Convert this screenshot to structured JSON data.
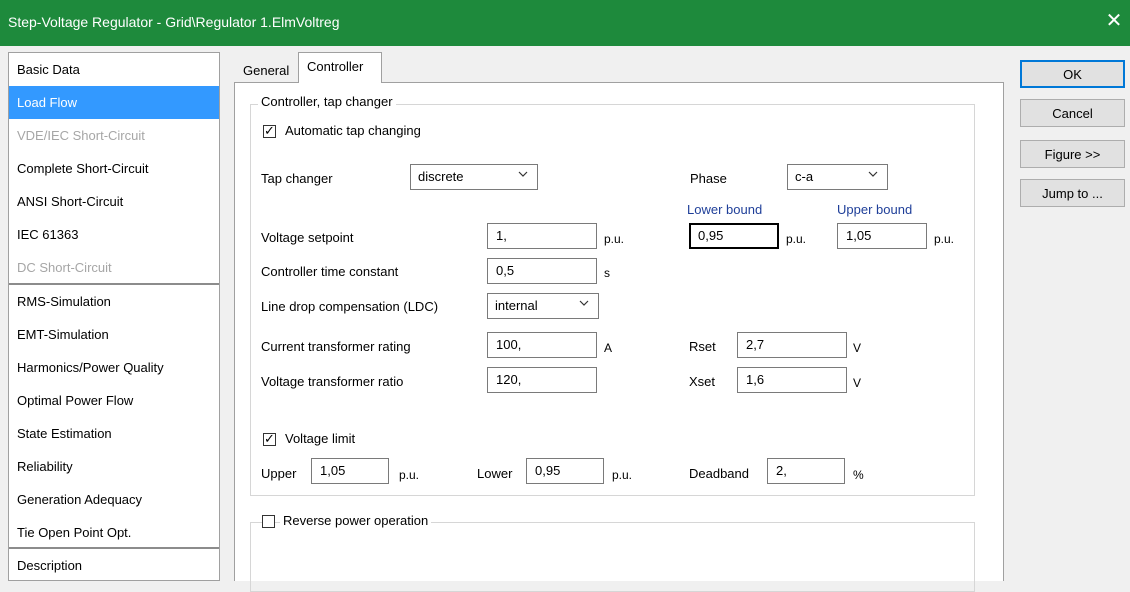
{
  "window": {
    "title": "Step-Voltage Regulator - Grid\\Regulator 1.ElmVoltreg",
    "close_glyph": "✕"
  },
  "sidebar": {
    "items": [
      {
        "label": "Basic Data",
        "state": "normal"
      },
      {
        "label": "Load Flow",
        "state": "selected"
      },
      {
        "label": "VDE/IEC Short-Circuit",
        "state": "disabled"
      },
      {
        "label": "Complete Short-Circuit",
        "state": "normal"
      },
      {
        "label": "ANSI Short-Circuit",
        "state": "normal"
      },
      {
        "label": "IEC 61363",
        "state": "normal"
      },
      {
        "label": "DC Short-Circuit",
        "state": "disabled"
      },
      {
        "label": "RMS-Simulation",
        "state": "normal"
      },
      {
        "label": "EMT-Simulation",
        "state": "normal"
      },
      {
        "label": "Harmonics/Power Quality",
        "state": "normal"
      },
      {
        "label": "Optimal Power Flow",
        "state": "normal"
      },
      {
        "label": "State Estimation",
        "state": "normal"
      },
      {
        "label": "Reliability",
        "state": "normal"
      },
      {
        "label": "Generation Adequacy",
        "state": "normal"
      },
      {
        "label": "Tie Open Point Opt.",
        "state": "normal"
      },
      {
        "label": "Description",
        "state": "normal"
      }
    ]
  },
  "tabs": [
    {
      "label": "General",
      "active": false
    },
    {
      "label": "Controller",
      "active": true
    }
  ],
  "controller_group": {
    "title": "Controller, tap changer",
    "automatic_tap_changing": {
      "label": "Automatic tap changing",
      "checked": true
    },
    "tap_changer": {
      "label": "Tap changer",
      "value": "discrete"
    },
    "phase": {
      "label": "Phase",
      "value": "c-a"
    },
    "lower_bound_header": "Lower bound",
    "upper_bound_header": "Upper bound",
    "voltage_setpoint": {
      "label": "Voltage setpoint",
      "value": "1,",
      "unit": "p.u."
    },
    "lower_bound": {
      "value": "0,95",
      "unit": "p.u."
    },
    "upper_bound": {
      "value": "1,05",
      "unit": "p.u."
    },
    "time_constant": {
      "label": "Controller time constant",
      "value": "0,5",
      "unit": "s"
    },
    "ldc": {
      "label": "Line drop compensation (LDC)",
      "value": "internal"
    },
    "ct_rating": {
      "label": "Current transformer rating",
      "value": "100,",
      "unit": "A"
    },
    "vt_ratio": {
      "label": "Voltage transformer ratio",
      "value": "120,"
    },
    "rset": {
      "label": "Rset",
      "value": "2,7",
      "unit": "V"
    },
    "xset": {
      "label": "Xset",
      "value": "1,6",
      "unit": "V"
    },
    "voltage_limit": {
      "label": "Voltage limit",
      "checked": true
    },
    "upper": {
      "label": "Upper",
      "value": "1,05",
      "unit": "p.u."
    },
    "lower": {
      "label": "Lower",
      "value": "0,95",
      "unit": "p.u."
    },
    "deadband": {
      "label": "Deadband",
      "value": "2,",
      "unit": "%"
    }
  },
  "reverse_power": {
    "label": "Reverse power operation",
    "checked": false
  },
  "buttons": {
    "ok": "OK",
    "cancel": "Cancel",
    "figure": "Figure >>",
    "jump": "Jump to ..."
  },
  "colors": {
    "titlebar": "#1e8a3c",
    "selection": "#3399ff",
    "blue_header": "#1f3f99"
  },
  "check_glyph": "✓"
}
